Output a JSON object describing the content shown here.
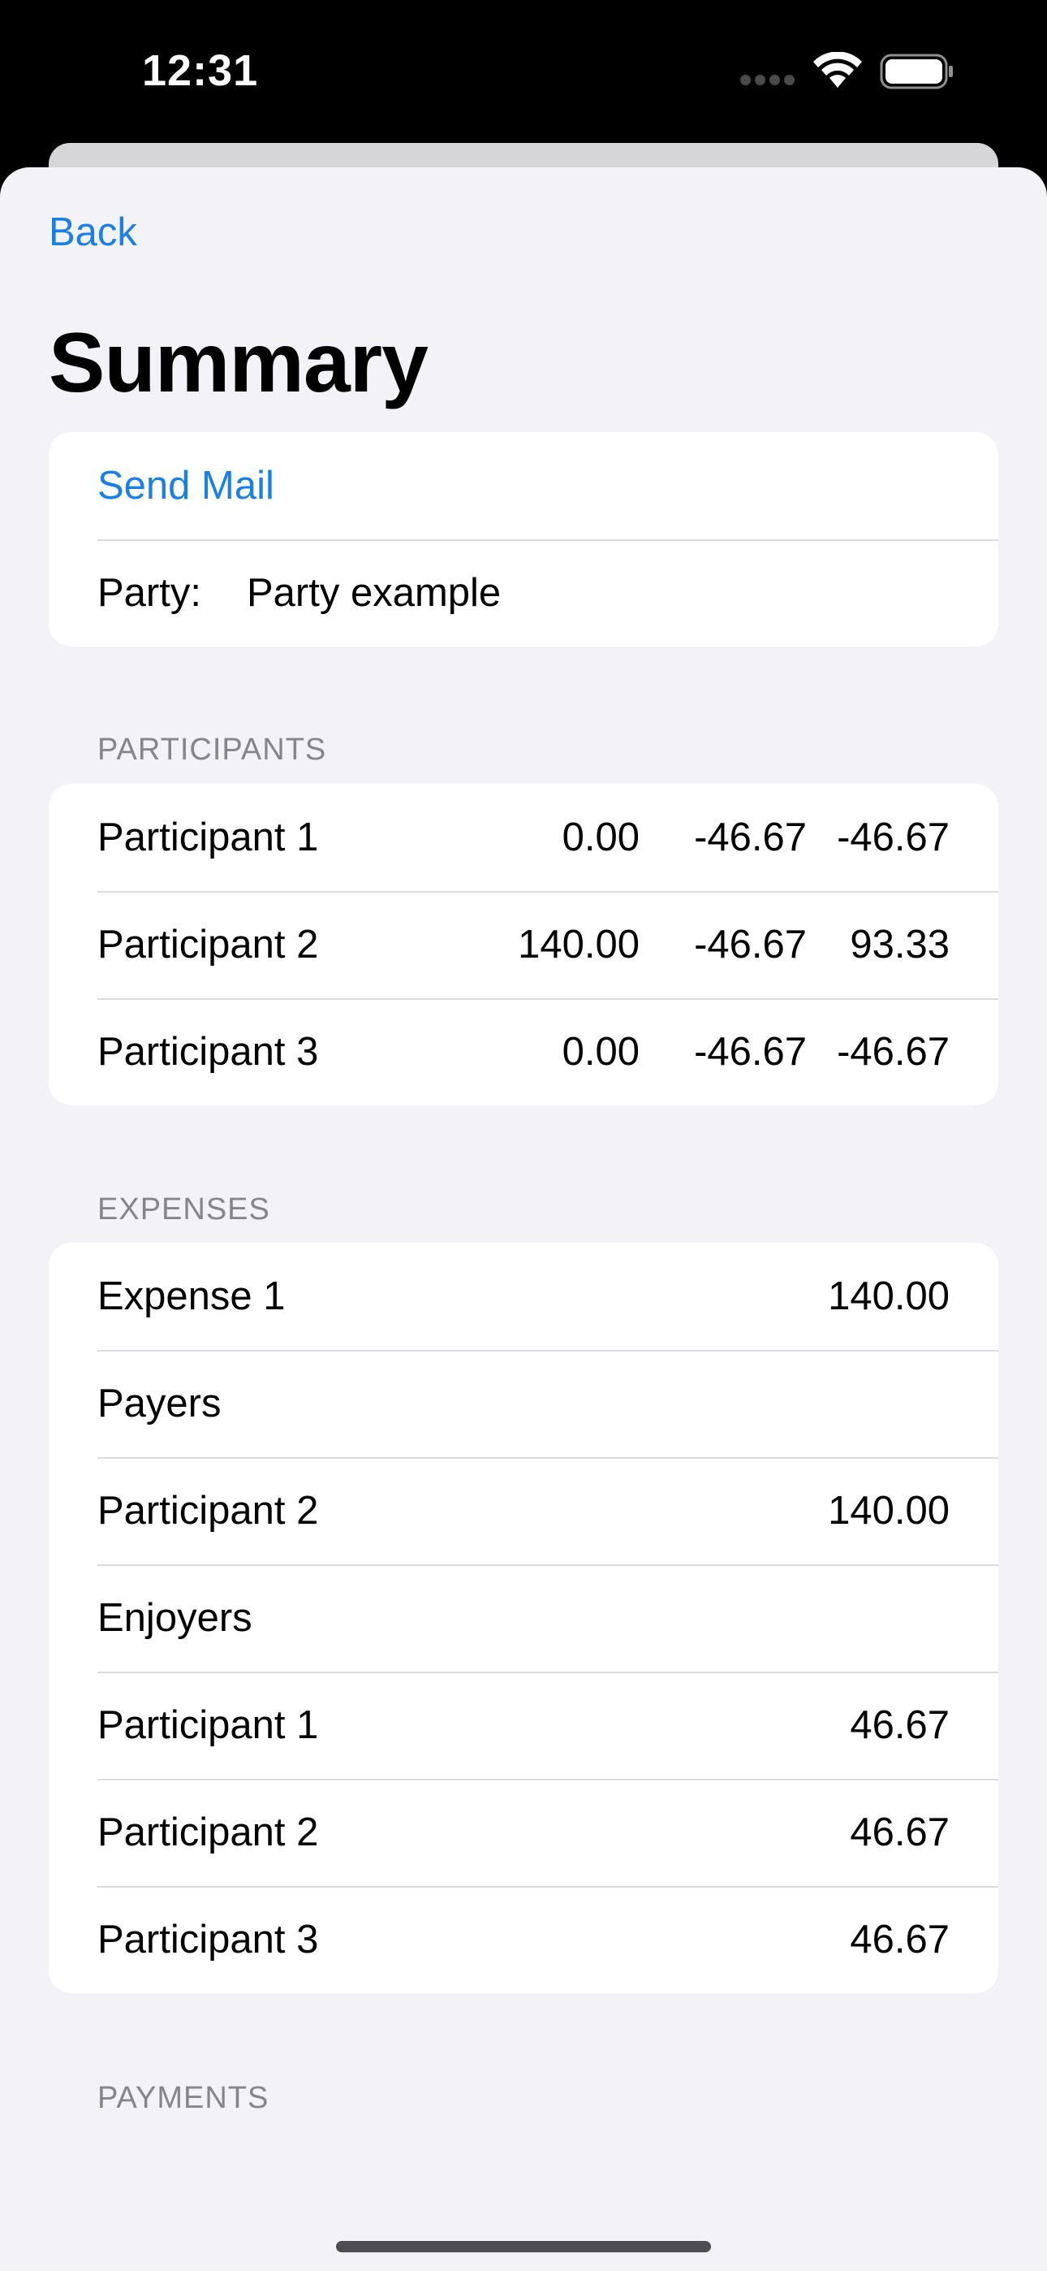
{
  "status_bar": {
    "time": "12:31"
  },
  "nav": {
    "back_label": "Back"
  },
  "page": {
    "title": "Summary"
  },
  "actions": {
    "send_mail_label": "Send Mail"
  },
  "party": {
    "label": "Party:",
    "value": "Party example"
  },
  "participants": {
    "header": "PARTICIPANTS",
    "rows": [
      {
        "name": "Participant 1",
        "paid": "0.00",
        "share": "-46.67",
        "balance": "-46.67"
      },
      {
        "name": "Participant 2",
        "paid": "140.00",
        "share": "-46.67",
        "balance": "93.33"
      },
      {
        "name": "Participant 3",
        "paid": "0.00",
        "share": "-46.67",
        "balance": "-46.67"
      }
    ]
  },
  "expenses": {
    "header": "EXPENSES",
    "rows": [
      {
        "label": "Expense 1",
        "value": "140.00"
      },
      {
        "label": "Payers",
        "value": ""
      },
      {
        "label": "Participant 2",
        "value": "140.00"
      },
      {
        "label": "Enjoyers",
        "value": ""
      },
      {
        "label": "Participant 1",
        "value": "46.67"
      },
      {
        "label": "Participant 2",
        "value": "46.67"
      },
      {
        "label": "Participant 3",
        "value": "46.67"
      }
    ]
  },
  "payments": {
    "header": "PAYMENTS"
  },
  "colors": {
    "accent": "#1a80e6",
    "background": "#f2f2f7",
    "card": "#ffffff",
    "secondary_text": "#85858b"
  }
}
